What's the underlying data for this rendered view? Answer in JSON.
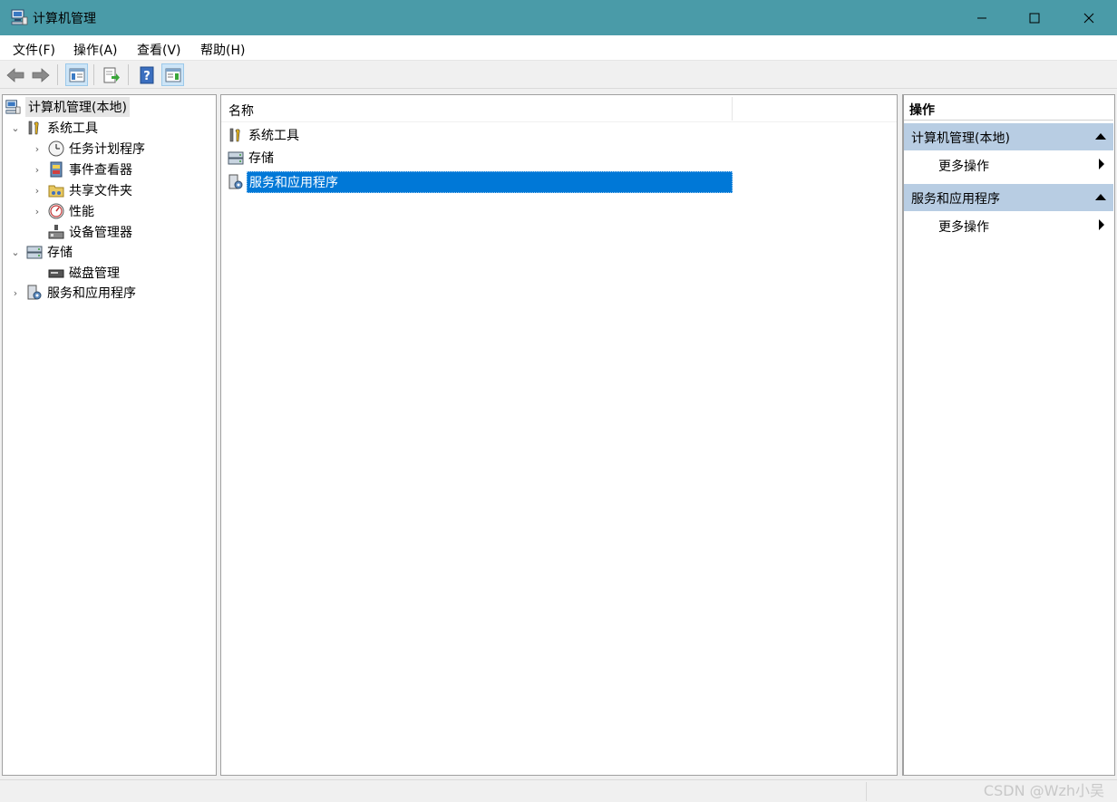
{
  "window": {
    "title": "计算机管理",
    "title_bar_color": "#4a9ba8"
  },
  "menu": {
    "items": [
      "文件(F)",
      "操作(A)",
      "查看(V)",
      "帮助(H)"
    ]
  },
  "toolbar": {
    "buttons": [
      "back-icon",
      "forward-icon",
      "show-hide-tree-icon",
      "export-list-icon",
      "help-icon",
      "show-hide-action-pane-icon"
    ]
  },
  "tree": {
    "root": "计算机管理(本地)",
    "items": [
      {
        "label": "系统工具",
        "icon": "tools-icon",
        "expanded": true
      },
      {
        "label": "任务计划程序",
        "icon": "clock-icon"
      },
      {
        "label": "事件查看器",
        "icon": "event-viewer-icon"
      },
      {
        "label": "共享文件夹",
        "icon": "shared-folder-icon"
      },
      {
        "label": "性能",
        "icon": "performance-icon"
      },
      {
        "label": "设备管理器",
        "icon": "device-manager-icon"
      },
      {
        "label": "存储",
        "icon": "storage-icon",
        "expanded": true
      },
      {
        "label": "磁盘管理",
        "icon": "disk-management-icon"
      },
      {
        "label": "服务和应用程序",
        "icon": "services-icon"
      }
    ]
  },
  "list": {
    "column_name": "名称",
    "rows": [
      {
        "label": "系统工具",
        "icon": "tools-icon"
      },
      {
        "label": "存储",
        "icon": "storage-icon"
      },
      {
        "label": "服务和应用程序",
        "icon": "services-icon",
        "selected": true
      }
    ],
    "selection_color": "#0078d7"
  },
  "actions": {
    "title": "操作",
    "groups": [
      {
        "label": "计算机管理(本地)",
        "item": "更多操作"
      },
      {
        "label": "服务和应用程序",
        "item": "更多操作"
      }
    ],
    "group_color": "#b8cde3"
  },
  "watermark": "CSDN @Wzh小吴"
}
